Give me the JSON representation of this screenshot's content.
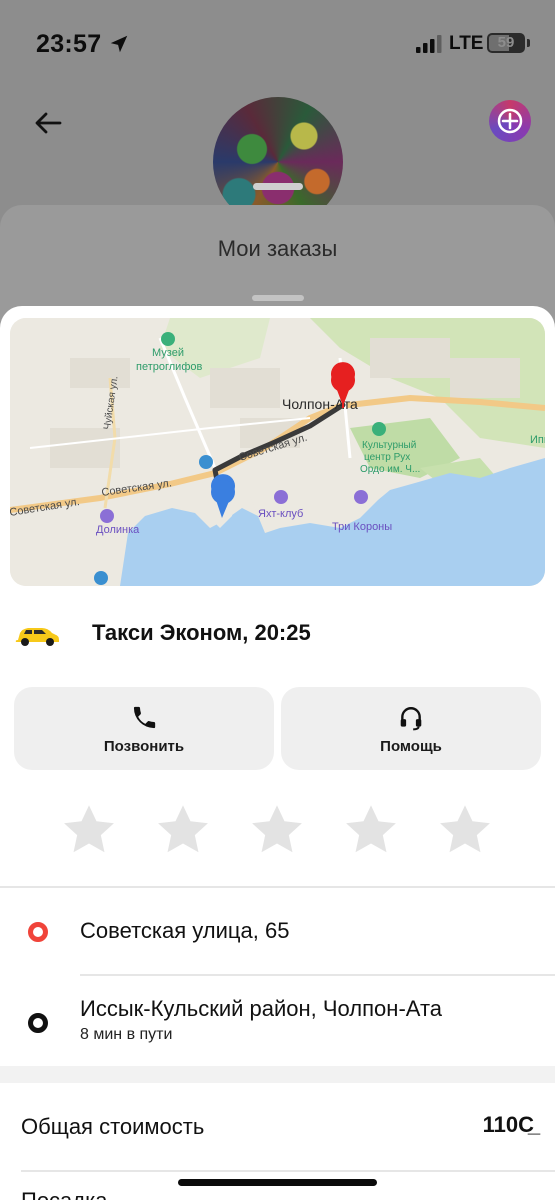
{
  "status_bar": {
    "time": "23:57",
    "network": "LTE",
    "battery": "59",
    "battery_level": 0.59
  },
  "header": {
    "back_icon": "arrow-left-icon",
    "promo_icon": "plus-badge-icon"
  },
  "orders_sheet": {
    "title": "Мои заказы"
  },
  "map": {
    "labels": {
      "museum": "Музей\nпетроглифов",
      "museum_line1": "Музей",
      "museum_line2": "петроглифов",
      "city": "Чолпон-Ата",
      "street1": "Советская ул.",
      "street2": "Советская ул.",
      "street3": "Советская ул.",
      "chuy": "Чуйская ул.",
      "culture_line1": "Культурный",
      "culture_line2": "центр Рух",
      "culture_line3": "Ордо им. Ч...",
      "yacht": "Яхт-клуб",
      "three_crowns": "Три Короны",
      "dolinka": "Долинка",
      "edge": "Ипп"
    }
  },
  "order": {
    "tariff_title": "Такси Эконом, 20:25",
    "car_icon": "taxi-car-icon"
  },
  "actions": {
    "call_label": "Позвонить",
    "help_label": "Помощь"
  },
  "rating": {
    "max": 5,
    "value": 0
  },
  "route": {
    "from": "Советская улица, 65",
    "to": "Иссык-Кульский район, Чолпон-Ата",
    "duration": "8 мин в пути"
  },
  "payment": {
    "total_label": "Общая стоимость",
    "total_value": "110С̲",
    "next_label": "Посадка"
  },
  "colors": {
    "from_marker": "#f0443a",
    "to_marker": "#111111",
    "star": "#e3e3e3",
    "button_bg": "#efefef"
  }
}
